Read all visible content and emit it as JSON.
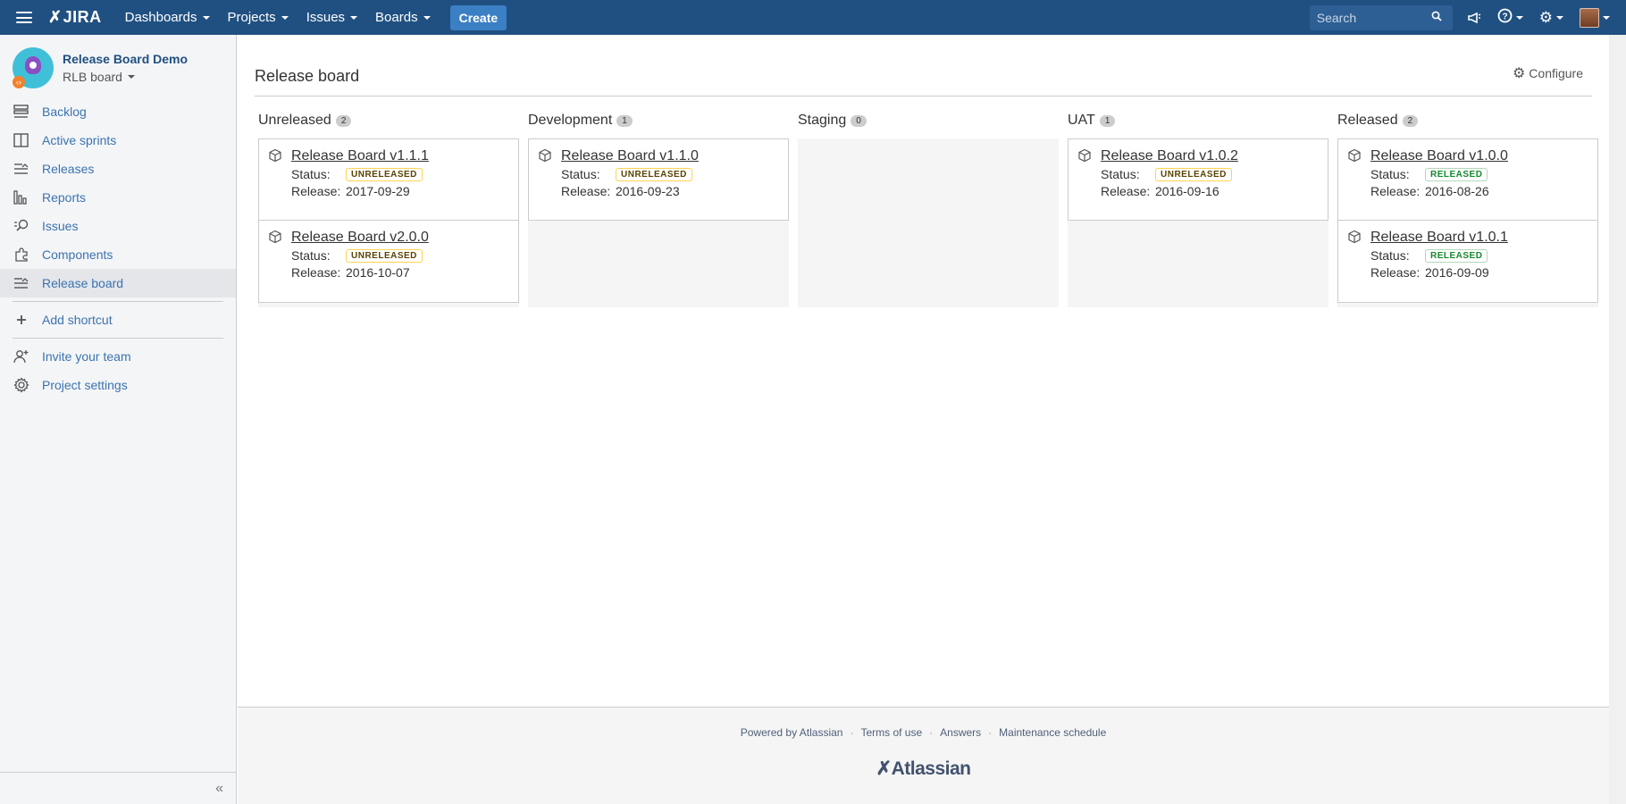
{
  "topbar": {
    "logo": "JIRA",
    "nav": [
      "Dashboards",
      "Projects",
      "Issues",
      "Boards"
    ],
    "create_label": "Create",
    "search_placeholder": "Search",
    "bg_color": "#205081"
  },
  "sidebar": {
    "project_name": "Release Board Demo",
    "board_name": "RLB board",
    "items": [
      {
        "label": "Backlog",
        "icon": "backlog-icon"
      },
      {
        "label": "Active sprints",
        "icon": "active-sprints-icon"
      },
      {
        "label": "Releases",
        "icon": "releases-icon"
      },
      {
        "label": "Reports",
        "icon": "reports-icon"
      },
      {
        "label": "Issues",
        "icon": "issues-icon"
      },
      {
        "label": "Components",
        "icon": "components-icon"
      },
      {
        "label": "Release board",
        "icon": "release-board-icon"
      }
    ],
    "add_shortcut": "Add shortcut",
    "invite_team": "Invite your team",
    "project_settings": "Project settings",
    "collapse_glyph": "«"
  },
  "main": {
    "title": "Release board",
    "configure_label": "Configure",
    "columns": [
      {
        "name": "Unreleased",
        "count": "2",
        "cards": [
          {
            "title": "Release Board v1.1.1",
            "status_label": "Status:",
            "status": "UNRELEASED",
            "release_label": "Release:",
            "release": "2017-09-29"
          },
          {
            "title": "Release Board v2.0.0",
            "status_label": "Status:",
            "status": "UNRELEASED",
            "release_label": "Release:",
            "release": "2016-10-07"
          }
        ]
      },
      {
        "name": "Development",
        "count": "1",
        "cards": [
          {
            "title": "Release Board v1.1.0",
            "status_label": "Status:",
            "status": "UNRELEASED",
            "release_label": "Release:",
            "release": "2016-09-23"
          }
        ]
      },
      {
        "name": "Staging",
        "count": "0",
        "cards": []
      },
      {
        "name": "UAT",
        "count": "1",
        "cards": [
          {
            "title": "Release Board v1.0.2",
            "status_label": "Status:",
            "status": "UNRELEASED",
            "release_label": "Release:",
            "release": "2016-09-16"
          }
        ]
      },
      {
        "name": "Released",
        "count": "2",
        "cards": [
          {
            "title": "Release Board v1.0.0",
            "status_label": "Status:",
            "status": "RELEASED",
            "release_label": "Release:",
            "release": "2016-08-26"
          },
          {
            "title": "Release Board v1.0.1",
            "status_label": "Status:",
            "status": "RELEASED",
            "release_label": "Release:",
            "release": "2016-09-09"
          }
        ]
      }
    ]
  },
  "footer": {
    "links": [
      "Powered by Atlassian",
      "Terms of use",
      "Answers",
      "Maintenance schedule"
    ],
    "logo": "Atlassian"
  }
}
